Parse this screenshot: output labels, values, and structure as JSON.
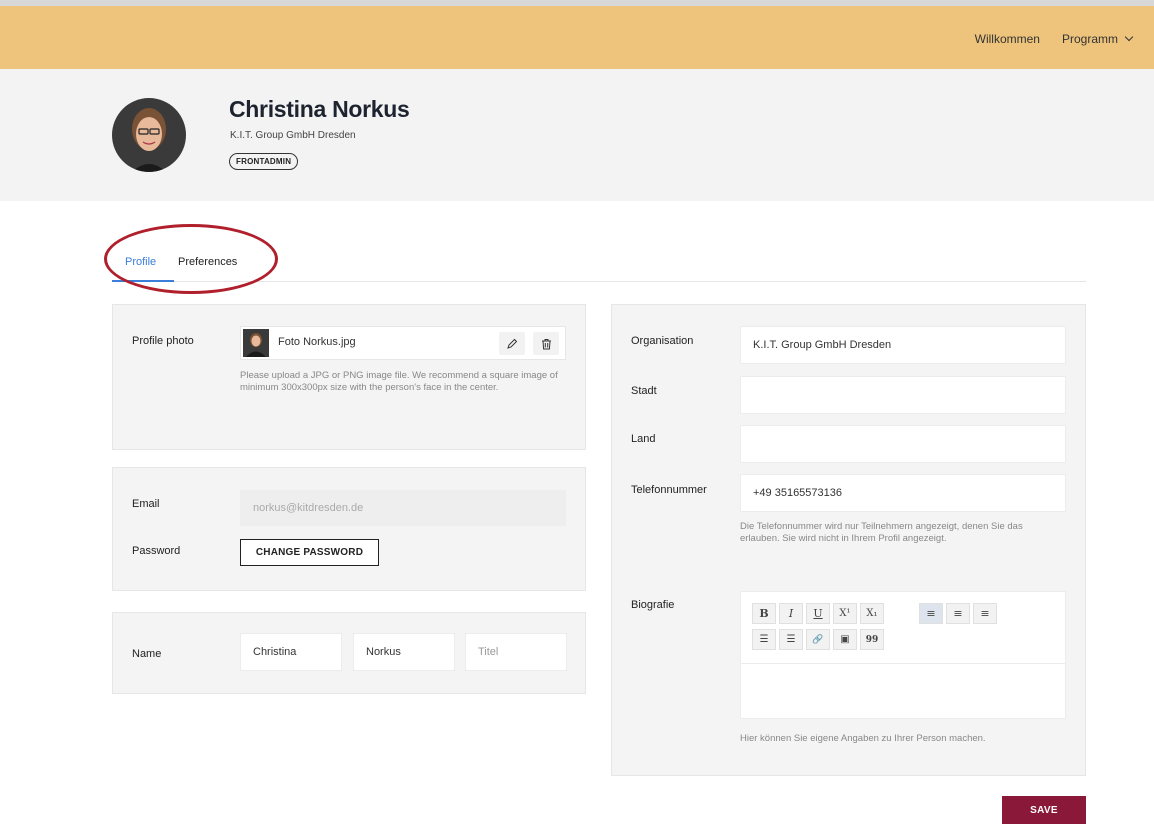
{
  "header": {
    "nav": {
      "welcome": "Willkommen",
      "program": "Programm"
    }
  },
  "profile": {
    "name": "Christina Norkus",
    "organisation": "K.I.T. Group GmbH Dresden",
    "role_badge": "FRONTADMIN"
  },
  "tabs": {
    "profile": "Profile",
    "preferences": "Preferences"
  },
  "photo": {
    "label": "Profile photo",
    "file_name": "Foto Norkus.jpg",
    "help": "Please upload a JPG or PNG image file. We recommend a square image of minimum 300x300px size with the person's face in the center."
  },
  "account": {
    "email_label": "Email",
    "email_value": "norkus@kitdresden.de",
    "password_label": "Password",
    "change_password": "CHANGE PASSWORD"
  },
  "name_section": {
    "label": "Name",
    "first": "Christina",
    "last": "Norkus",
    "title_placeholder": "Titel"
  },
  "details": {
    "organisation_label": "Organisation",
    "organisation_value": "K.I.T. Group GmbH Dresden",
    "city_label": "Stadt",
    "city_value": "",
    "country_label": "Land",
    "country_value": "",
    "phone_label": "Telefonnummer",
    "phone_value": "+49 35165573136",
    "phone_help": "Die Telefonnummer wird nur Teilnehmern angezeigt, denen Sie das erlauben. Sie wird nicht in Ihrem Profil angezeigt.",
    "bio_label": "Biografie",
    "bio_help": "Hier können Sie eigene Angaben zu Ihrer Person machen."
  },
  "editor_toolbar": {
    "bold": "B",
    "italic": "I",
    "underline": "U",
    "superscript": "X¹",
    "subscript": "X₁",
    "align_left": "≡",
    "align_center": "≡",
    "align_right": "≡",
    "ordered_list": "☰",
    "unordered_list": "☰",
    "link": "🔗",
    "image": "▣",
    "quote": "99"
  },
  "actions": {
    "save": "SAVE"
  },
  "colors": {
    "header": "#eec47c",
    "accent": "#3b7dd8",
    "save": "#8a1838",
    "annotation": "#b01f2b"
  }
}
